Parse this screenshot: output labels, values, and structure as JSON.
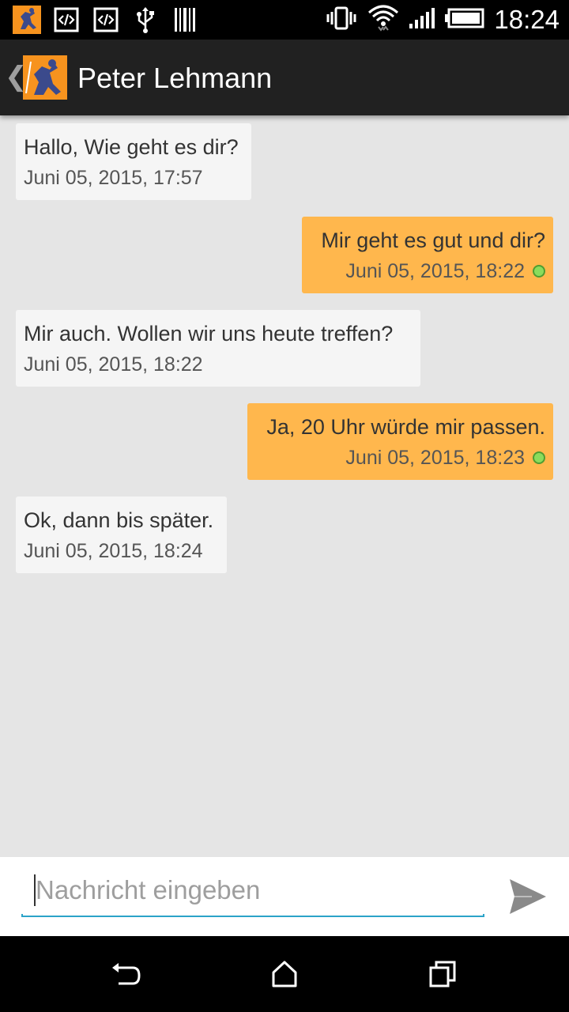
{
  "status_bar": {
    "time": "18:24",
    "left_icons": [
      "app-icon",
      "code-icon",
      "code-icon",
      "usb-icon",
      "barcode-icon"
    ],
    "right_icons": [
      "vibrate-icon",
      "wifi-icon",
      "signal-icon",
      "battery-icon"
    ]
  },
  "header": {
    "back_glyph": "❮",
    "title": "Peter Lehmann",
    "avatar_icon": "avatar-icon"
  },
  "messages": [
    {
      "direction": "in",
      "text": "Hallo, Wie geht es dir?",
      "time": "Juni 05, 2015, 17:57"
    },
    {
      "direction": "out",
      "text": "Mir geht es gut und dir?",
      "time": "Juni 05, 2015, 18:22",
      "status": "delivered"
    },
    {
      "direction": "in",
      "text": "Mir auch. Wollen wir uns heute treffen?",
      "time": "Juni 05, 2015, 18:22"
    },
    {
      "direction": "out",
      "text": "Ja, 20 Uhr würde mir passen.",
      "time": "Juni 05, 2015, 18:23",
      "status": "delivered"
    },
    {
      "direction": "in",
      "text": "Ok, dann bis später.",
      "time": "Juni 05, 2015, 18:24"
    }
  ],
  "composer": {
    "placeholder": "Nachricht eingeben",
    "value": "",
    "send_icon": "send-icon"
  },
  "navigation": {
    "buttons": [
      "back-icon",
      "home-icon",
      "recent-apps-icon"
    ]
  },
  "colors": {
    "incoming_bubble": "#f5f5f5",
    "outgoing_bubble": "#ffb74d",
    "accent": "#2ba3c8",
    "delivered_dot": "#8bdc5c",
    "actionbar": "#212121",
    "chat_background": "#e5e5e5"
  }
}
